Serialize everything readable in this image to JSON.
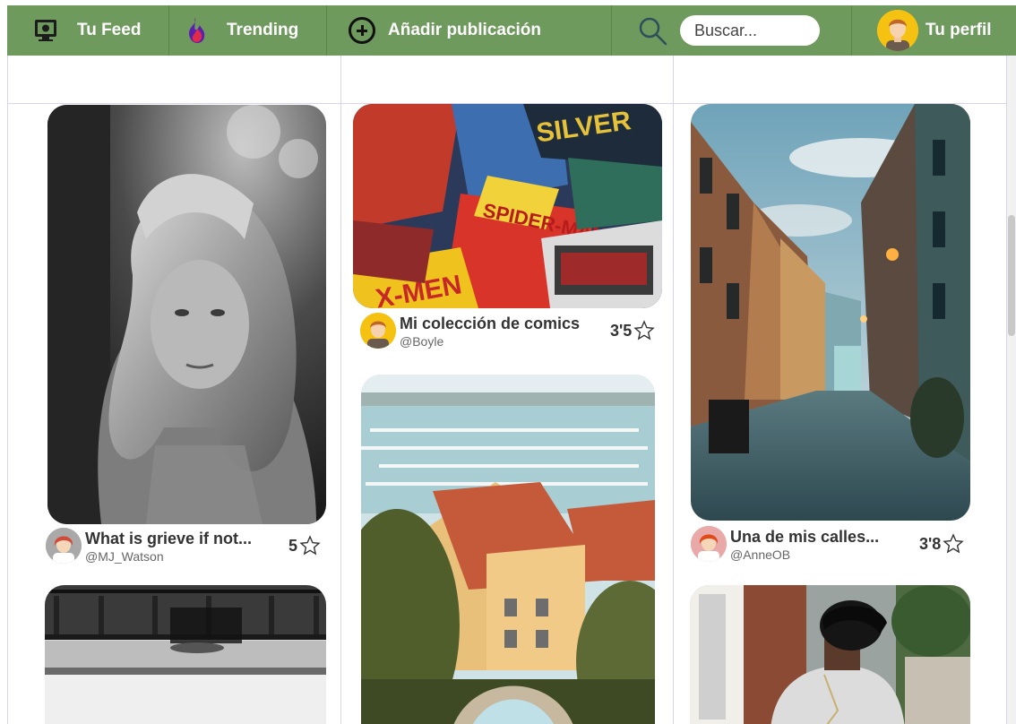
{
  "nav": {
    "feed_label": "Tu Feed",
    "trending_label": "Trending",
    "add_label": "Añadir publicación",
    "search_placeholder": "Buscar...",
    "profile_label": "Tu perfil",
    "icons": [
      "computer-icon",
      "flame-icon",
      "plus-circle-icon",
      "search-icon",
      "user-avatar"
    ]
  },
  "colors": {
    "nav_bg": "#6f9a5e",
    "grid_lines": "#d7d3f1"
  },
  "posts": [
    {
      "title": "What is grieve if not...",
      "user": "@MJ_Watson",
      "rating": "5"
    },
    {
      "title": "Mi colección de comics",
      "user": "@Boyle",
      "rating": "3'5"
    },
    {
      "title": "Una de mis calles...",
      "user": "@AnneOB",
      "rating": "3'8"
    }
  ]
}
